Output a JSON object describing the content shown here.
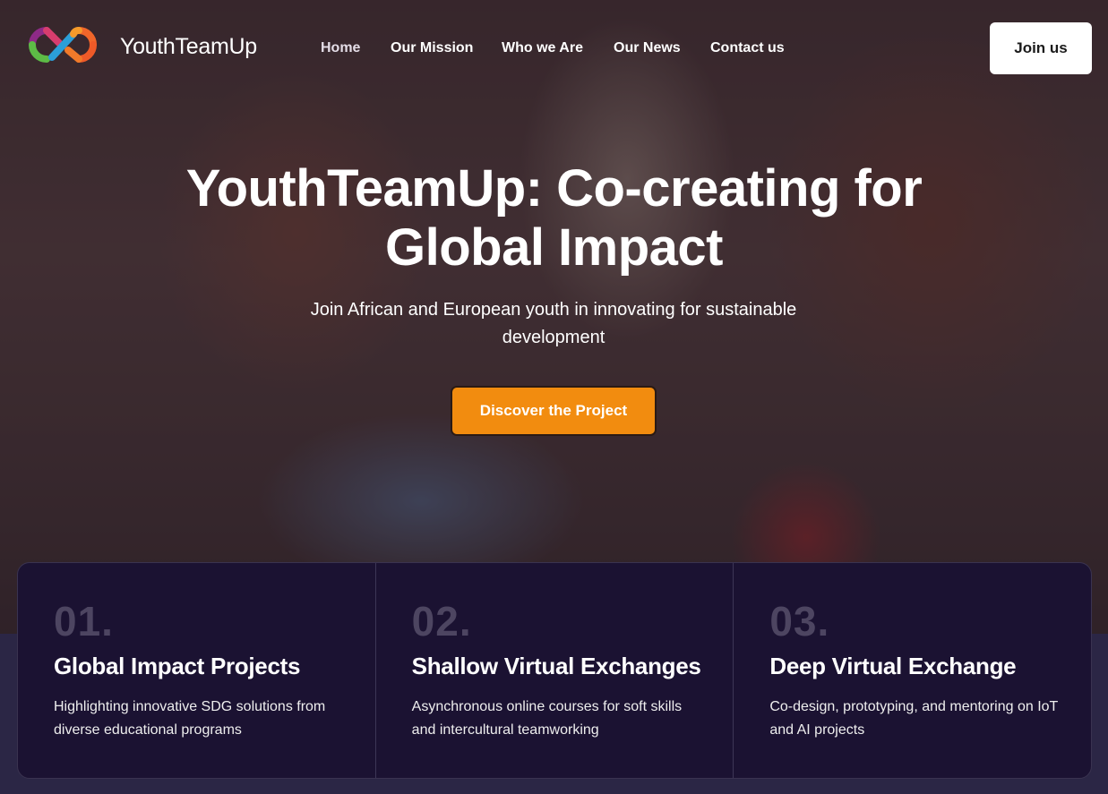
{
  "brand": {
    "name": "YouthTeamUp"
  },
  "nav": {
    "items": [
      {
        "label": "Home",
        "active": true
      },
      {
        "label": "Our Mission"
      },
      {
        "label": "Who we Are"
      },
      {
        "label": "Our News"
      },
      {
        "label": "Contact us"
      }
    ],
    "join_label": "Join us"
  },
  "hero": {
    "title_line1": "YouthTeamUp: Co-creating for",
    "title_line2": "Global Impact",
    "subtitle_line1": "Join African and European youth in innovating for sustainable",
    "subtitle_line2": "development",
    "cta_label": "Discover the Project"
  },
  "features": [
    {
      "number": "01.",
      "title": "Global Impact Projects",
      "desc": "Highlighting innovative SDG solutions from diverse educational programs"
    },
    {
      "number": "02.",
      "title": "Shallow Virtual Exchanges",
      "desc": "Asynchronous online courses for soft skills and intercultural teamworking"
    },
    {
      "number": "03.",
      "title": "Deep Virtual Exchange",
      "desc": "Co-design, prototyping, and mentoring on IoT and AI projects"
    }
  ],
  "colors": {
    "accent": "#f28c0f",
    "panel": "#1b1232",
    "page_band": "#2b2645",
    "logo_purple": "#8e2a87",
    "logo_green": "#5dbb46",
    "logo_blue": "#2b9fd8",
    "logo_orange": "#f0662a"
  },
  "icons": {
    "logo": "infinity-loop-logo-icon"
  }
}
